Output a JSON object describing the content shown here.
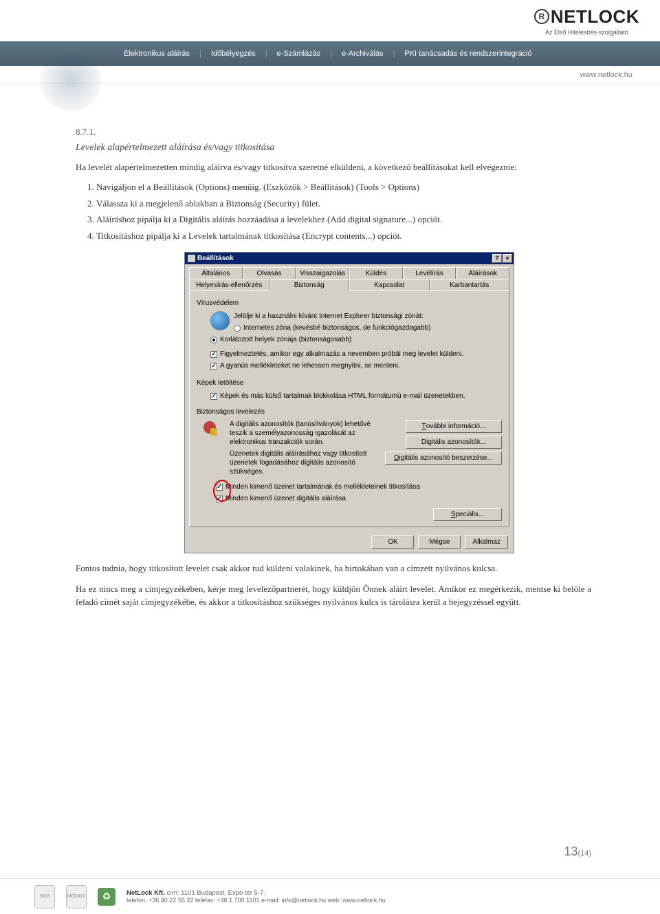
{
  "header": {
    "logo_text": "NETLOCK",
    "logo_sub": "Az Első Hitelesítés-szolgáltató",
    "nav": [
      "Elektronikus aláírás",
      "Időbélyegzés",
      "e-Számlázás",
      "e-Archiválás",
      "PKI tanácsadás és rendszerintegráció"
    ],
    "url": "www.netlock.hu"
  },
  "section": {
    "num": "8.7.1.",
    "title": "Levelek alapértelmezett aláírása és/vagy titkosítása",
    "intro": "Ha levelét alapértelmezetten mindig aláírva és/vagy titkosítva szeretné elküldeni, a következő beállításokat kell elvégeznie:",
    "steps": [
      "Navigáljon el a Beállítások (Options) menüig. (Eszközök > Beállítások) (Tools > Options)",
      "Válassza ki a megjelenő ablakban a Biztonság (Security) fület.",
      "Aláíráshoz pipálja ki a Digitális aláírás hozzáadása a levelekhez (Add digital signature...) opciót.",
      "Titkosításhoz pipálja ki a Levelek tartalmának titkosítása (Encrypt contents...) opciót."
    ],
    "after1": "Fontos tudnia, hogy titkosított levelet csak akkor tud küldeni valakinek, ha birtokában van a címzett nyilvános kulcsa.",
    "after2": "Ha ez nincs meg a címjegyzékében, kérje meg levelezőpartnerét, hogy küldjön Önnek aláírt levelet. Amikor ez megérkezik, mentse ki belőle a feladó címét saját címjegyzékébe, és akkor a titkosításhoz szükséges nyilvános kulcs is tárolásra kerül a bejegyzéssel együtt."
  },
  "dialog": {
    "title": "Beállítások",
    "tabs_row1": [
      "Általános",
      "Olvasás",
      "Visszaigazolás",
      "Küldés",
      "Levélírás",
      "Aláírások"
    ],
    "tabs_row2": [
      "Helyesírás-ellenőrzés",
      "Biztonság",
      "Kapcsolat",
      "Karbantartás"
    ],
    "vp_label": "Vírusvédelem",
    "vp_hint": "Jelölje ki a használni kívánt Internet Explorer biztonsági zónát:",
    "radio1": "Internetes zóna (kevésbé biztonságos, de funkciógazdagabb)",
    "radio2": "Korlátozott helyek zónája (biztonságosabb)",
    "chk_warn": "Figyelmeztetés, amikor egy alkalmazás a nevemben próbál meg levelet küldeni.",
    "chk_att": "A gyanús mellékleteket ne lehessen megnyitni, se menteni.",
    "img_label": "Képek letöltése",
    "chk_img": "Képek és más külső tartalmak blokkolása HTML formátumú e-mail üzenetekben.",
    "sec_label": "Biztonságos levelezés",
    "sec_text1": "A digitális azonosítók (tanúsítványok) lehetővé teszik a személyazonosság igazolását az elektronikus tranzakciók során.",
    "sec_text2": "Üzenetek digitális aláírásához vagy titkosított üzenetek fogadásához digitális azonosító szükséges.",
    "btn_more": "További információ...",
    "btn_ids": "Digitális azonosítók...",
    "btn_get": "Digitális azonosító beszerzése...",
    "chk_enc": "Minden kimenő üzenet tartalmának és mellékleteinek titkosítása",
    "chk_sign": "Minden kimenő üzenet digitális aláírása",
    "btn_spec": "Speciális...",
    "ok": "OK",
    "cancel": "Mégse",
    "apply": "Alkalmaz"
  },
  "page": {
    "current": "13",
    "total": "(14)"
  },
  "footer": {
    "company": "NetLock Kft.",
    "addr": "cím: 1101 Budapest, Expo tér 5-7.",
    "contact": "telefon: +36 40 22 55 22  telefax: +36 1 700 1101  e-mail: info@netlock.hu  web: www.netlock.hu"
  }
}
